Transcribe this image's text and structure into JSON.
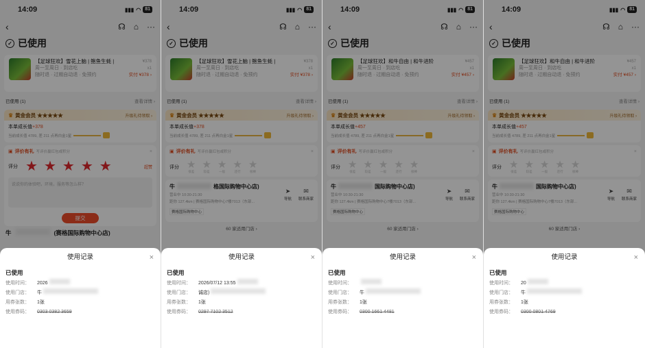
{
  "status": {
    "time": "14:09",
    "battery": "81"
  },
  "order_state": "已使用",
  "labels": {
    "used_count": "已使用 (1)",
    "view_details": "查看详情 ›",
    "gold_member": "黄金会员 ★★★★★",
    "upgrade_gift": "升级礼待领取 ›",
    "growth_label": "本单成长值",
    "growth_sub": "当前成长值 4789, 差 211 点再白金1星",
    "review_tag": "评价有礼",
    "review_hint": "写评价赢红包或积分",
    "rating_label": "评分",
    "rating_super": "超赞",
    "review_placeholder": "说说你的体验吧，环境，服务等怎么样？",
    "submit": "提交",
    "more_stores": "60 家适用门店 ›",
    "nav_label": "导航",
    "contact_label": "联系商家",
    "address": "距你 127.4km | 赛格国际购物中心7楼7013（东部...",
    "hours": "营业中 10:30-21:30",
    "mall_chip": "赛格国际购物中心",
    "store_prefix": "牛",
    "store_suffix": "格国际购物中心店)",
    "store_suffix_b": "(赛格国际购物中心店)",
    "store_suffix_c": "国际购物中心店)"
  },
  "star_texts": [
    "很差",
    "较差",
    "一般",
    "还行",
    "很棒"
  ],
  "sheet_labels": {
    "title": "使用记录",
    "state": "已使用",
    "k_time": "使用时间：",
    "k_store": "使用门店：",
    "k_count": "用券张数：",
    "k_code": "使用券码："
  },
  "phones": [
    {
      "product": "【足球狂欢】雪花上脑 | 鲍鱼生蚝 |",
      "subline": "周一至周日 · 到店吃",
      "tags": "随时退 · 过期自动退 · 免预约",
      "price": "¥378",
      "paid": "实付 ¥378 ›",
      "qty": "x1",
      "growth": "+378",
      "sheet": {
        "time": "2026",
        "store": "牛",
        "count": "1张",
        "code": "0303 0382 3659"
      }
    },
    {
      "product": "【足球狂欢】雪花上脑 | 鲍鱼生蚝 |",
      "subline": "周一至周日 · 到店吃",
      "tags": "随时退 · 过期自动退 · 免预约",
      "price": "¥378",
      "paid": "实付 ¥378 ›",
      "qty": "x1",
      "growth": "+378",
      "sheet": {
        "time": "2026/07/12 13:55",
        "store": "诚店)",
        "count": "1张",
        "code": "0297 7102 3512"
      }
    },
    {
      "product": "【足球狂欢】和牛自由 | 和牛进阶",
      "subline": "周一至周日 · 到店吃",
      "tags": "随时退 · 过期自动退 · 免预约",
      "price": "¥457",
      "paid": "实付 ¥457 ›",
      "qty": "x1",
      "growth": "+457",
      "sheet": {
        "time": "",
        "store": "牛",
        "count": "1张",
        "code": "0300 1661 4481"
      }
    },
    {
      "product": "【足球狂欢】和牛自由 | 和牛进阶",
      "subline": "周一至周日 · 到店吃",
      "tags": "随时退 · 过期自动退 · 免预约",
      "price": "¥457",
      "paid": "实付 ¥457 ›",
      "qty": "x1",
      "growth": "+457",
      "sheet": {
        "time": "20",
        "store": "牛",
        "count": "1张",
        "code": "0300 0801 4769"
      }
    }
  ]
}
